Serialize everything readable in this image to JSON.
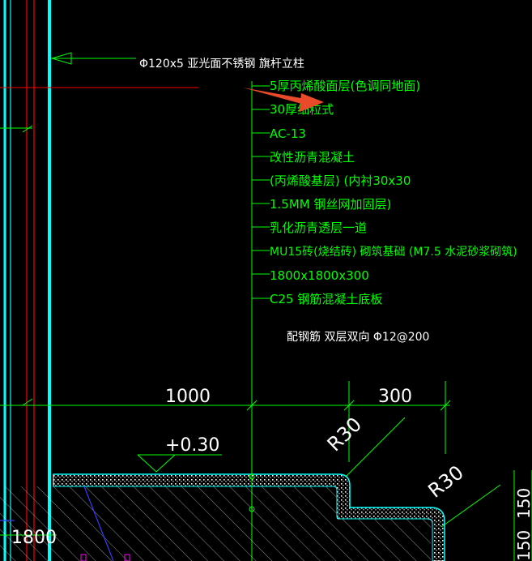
{
  "drawing": {
    "callout_post": "Φ120x5 亚光面不锈钢  旗杆立柱",
    "layers": [
      "5厚丙烯酸面层(色调同地面)",
      "30厚细粒式",
      "AC-13",
      "改性沥青混凝土",
      "(丙烯酸基层) (内衬30x30",
      "1.5MM 钢丝网加固层)",
      "乳化沥青透层一道",
      "MU15砖(烧结砖) 砌筑基础 (M7.5 水泥砂浆砌筑)",
      "1800x1800x300",
      "C25 钢筋混凝土底板"
    ],
    "rebar_note": "配钢筋  双层双向  Φ12@200",
    "dim_1000": "1000",
    "dim_300": "300",
    "radius_1": "R30",
    "radius_2": "R30",
    "elevation": "+0.30",
    "dim_1800": "1800",
    "dim_150a": "150",
    "dim_150b": "150"
  },
  "colors": {
    "background": "#000000",
    "cyan": "#00ffff",
    "green": "#00ff00",
    "red": "#ff0000",
    "blue": "#3a3aff",
    "white": "#ffffff",
    "magenta": "#ff00ff",
    "arrow": "#e84a2a"
  }
}
